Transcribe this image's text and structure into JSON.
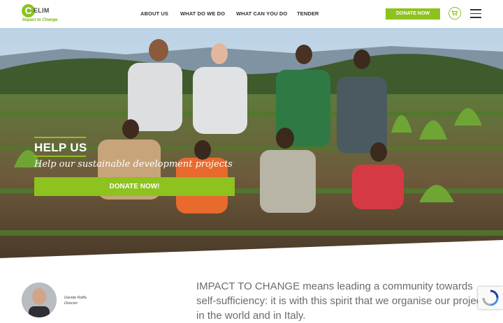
{
  "brand": {
    "logo_text": "ELIM",
    "logo_letter": "C",
    "tagline": "Impact to Change"
  },
  "nav": {
    "items": [
      "ABOUT US",
      "WHAT DO WE DO",
      "WHAT CAN YOU DO",
      "TENDER"
    ]
  },
  "header": {
    "donate_label": "DONATE NOW"
  },
  "hero": {
    "title": "HELP US",
    "subtitle": "Help our sustainable development projects",
    "cta_label": "DONATE NOW!"
  },
  "team": {
    "name": "Davide Raffa",
    "role": "Director"
  },
  "intro": {
    "text": "IMPACT TO CHANGE means leading a community towards self-sufficiency: it is with this spirit that we organise our projects in the world and in Italy."
  },
  "colors": {
    "accent": "#8dc21f",
    "text_dark": "#2f2f2f",
    "text_muted": "#6b6b6b"
  },
  "icons": {
    "cart": "cart-icon",
    "menu": "hamburger-menu-icon",
    "recaptcha": "recaptcha-icon"
  }
}
